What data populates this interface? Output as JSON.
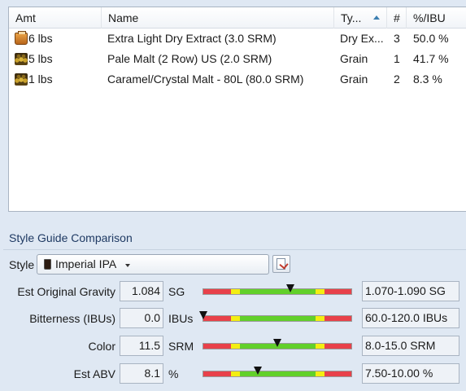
{
  "grid": {
    "columns": [
      "Amt",
      "Name",
      "Ty...",
      "#",
      "%/IBU"
    ],
    "rows": [
      {
        "icon": "extract-icon",
        "amount": "6 lbs",
        "name": "Extra Light Dry Extract (3.0 SRM)",
        "type": "Dry Ex...",
        "num": "3",
        "pct": "50.0 %"
      },
      {
        "icon": "grain-icon",
        "amount": "5 lbs",
        "name": "Pale Malt (2 Row) US (2.0 SRM)",
        "type": "Grain",
        "num": "1",
        "pct": "41.7 %"
      },
      {
        "icon": "grain-icon",
        "amount": "1 lbs",
        "name": "Caramel/Crystal Malt - 80L (80.0 SRM)",
        "type": "Grain",
        "num": "2",
        "pct": "8.3 %"
      }
    ]
  },
  "style_guide": {
    "title": "Style Guide Comparison",
    "style_label": "Style",
    "style_value": "Imperial IPA",
    "metrics": [
      {
        "label": "Est Original Gravity",
        "value": "1.084",
        "unit": "SG",
        "level": 0.59,
        "range": "1.070-1.090 SG"
      },
      {
        "label": "Bitterness (IBUs)",
        "value": "0.0",
        "unit": "IBUs",
        "level": 0.0,
        "range": "60.0-120.0 IBUs"
      },
      {
        "label": "Color",
        "value": "11.5",
        "unit": "SRM",
        "level": 0.5,
        "range": "8.0-15.0 SRM"
      },
      {
        "label": "Est ABV",
        "value": "8.1",
        "unit": "%",
        "level": 0.37,
        "range": "7.50-10.00 %"
      }
    ]
  }
}
